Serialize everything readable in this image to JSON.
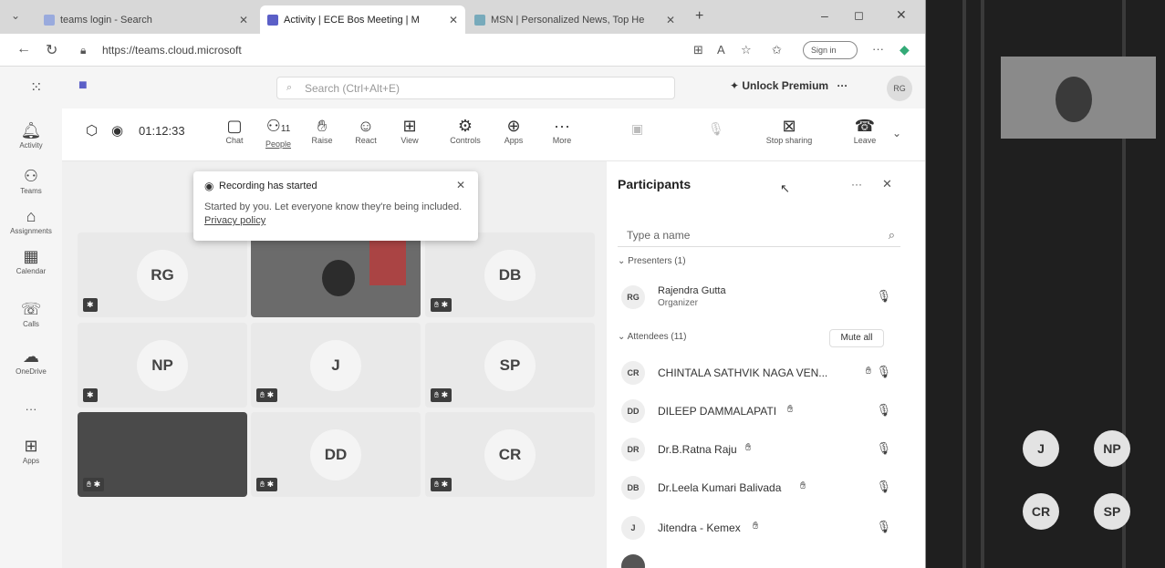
{
  "tabs": [
    {
      "label": "teams login - Search"
    },
    {
      "label": "Activity | ECE Bos Meeting | M"
    },
    {
      "label": "MSN | Personalized News, Top He"
    }
  ],
  "address": {
    "url": "https://teams.cloud.microsoft",
    "sign_in": "Sign in"
  },
  "teams_header": {
    "search_placeholder": "Search (Ctrl+Alt+E)",
    "premium": "Unlock Premium",
    "avatar": "RG",
    "more": "···"
  },
  "rail": [
    {
      "label": "Activity",
      "icon": "bell-icon"
    },
    {
      "label": "Teams",
      "icon": "teams-icon"
    },
    {
      "label": "Assignments",
      "icon": "assignments-icon"
    },
    {
      "label": "Calendar",
      "icon": "calendar-icon"
    },
    {
      "label": "Calls",
      "icon": "phone-icon"
    },
    {
      "label": "OneDrive",
      "icon": "cloud-icon"
    },
    {
      "label": "···",
      "icon": "more-icon"
    },
    {
      "label": "Apps",
      "icon": "apps-icon"
    }
  ],
  "meeting": {
    "timer": "01:12:33",
    "buttons": [
      "Chat",
      "People",
      "Raise",
      "React",
      "View",
      "Controls",
      "Apps",
      "More",
      "Stop sharing",
      "Leave"
    ],
    "people_count": "11"
  },
  "toast": {
    "title": "Recording has started",
    "body": "Started by you. Let everyone know they're being included.",
    "link": "Privacy policy"
  },
  "tiles": [
    "RG",
    "",
    "DB",
    "NP",
    "J",
    "SP",
    "",
    "DD",
    "CR"
  ],
  "panel": {
    "title": "Participants",
    "search_placeholder": "Type a name",
    "presenters_label": "Presenters (1)",
    "attendees_label": "Attendees (11)",
    "mute_all": "Mute all",
    "presenter": {
      "initials": "RG",
      "name": "Rajendra Gutta",
      "role": "Organizer"
    },
    "attendees": [
      {
        "initials": "CR",
        "name": "CHINTALA SATHVIK NAGA VEN..."
      },
      {
        "initials": "DD",
        "name": "DILEEP DAMMALAPATI"
      },
      {
        "initials": "DR",
        "name": "Dr.B.Ratna Raju"
      },
      {
        "initials": "DB",
        "name": "Dr.Leela Kumari Balivada"
      },
      {
        "initials": "J",
        "name": "Jitendra - Kemex"
      }
    ]
  },
  "right_circles": [
    "J",
    "NP",
    "CR",
    "SP"
  ],
  "colors": {
    "accent": "#5b5fc7",
    "dark": "#1f1f1f"
  }
}
